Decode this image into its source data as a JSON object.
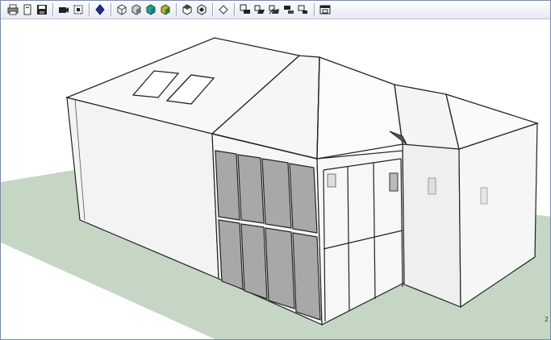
{
  "window": {
    "status_number": "2"
  },
  "toolbar": {
    "buttons": [
      {
        "name": "print-button",
        "icon": "printer-icon"
      },
      {
        "name": "new-button",
        "icon": "new-file-icon"
      },
      {
        "name": "save-button",
        "icon": "floppy-disk-icon"
      },
      {
        "name": "camera-button",
        "icon": "camera-icon"
      },
      {
        "name": "zoom-extents-button",
        "icon": "zoom-extents-icon"
      },
      {
        "name": "style-button",
        "icon": "blue-gem-icon"
      },
      {
        "name": "xray-button",
        "icon": "xray-cube-icon"
      },
      {
        "name": "wireframe-button",
        "icon": "wireframe-cube-icon"
      },
      {
        "name": "shaded-button",
        "icon": "shaded-cube-icon"
      },
      {
        "name": "textured-button",
        "icon": "textured-cube-icon"
      },
      {
        "name": "iso-view-button",
        "icon": "iso-cube-icon"
      },
      {
        "name": "top-view-button",
        "icon": "top-view-icon"
      },
      {
        "name": "front-view-button",
        "icon": "front-view-icon"
      },
      {
        "name": "section-plane-button",
        "icon": "section-plane-icon"
      },
      {
        "name": "section-cut-button",
        "icon": "section-cut-icon"
      },
      {
        "name": "section-display-button",
        "icon": "section-display-icon"
      },
      {
        "name": "section-fill-button",
        "icon": "section-fill-icon"
      },
      {
        "name": "section-export-button",
        "icon": "section-export-icon"
      },
      {
        "name": "window-layout-button",
        "icon": "window-layout-icon"
      }
    ]
  },
  "colors": {
    "ground": "#c5d6c5",
    "wall": "#f5f5f5",
    "roof": "#f8f8f8",
    "glass": "#a8a8a8",
    "edge": "#222222"
  }
}
